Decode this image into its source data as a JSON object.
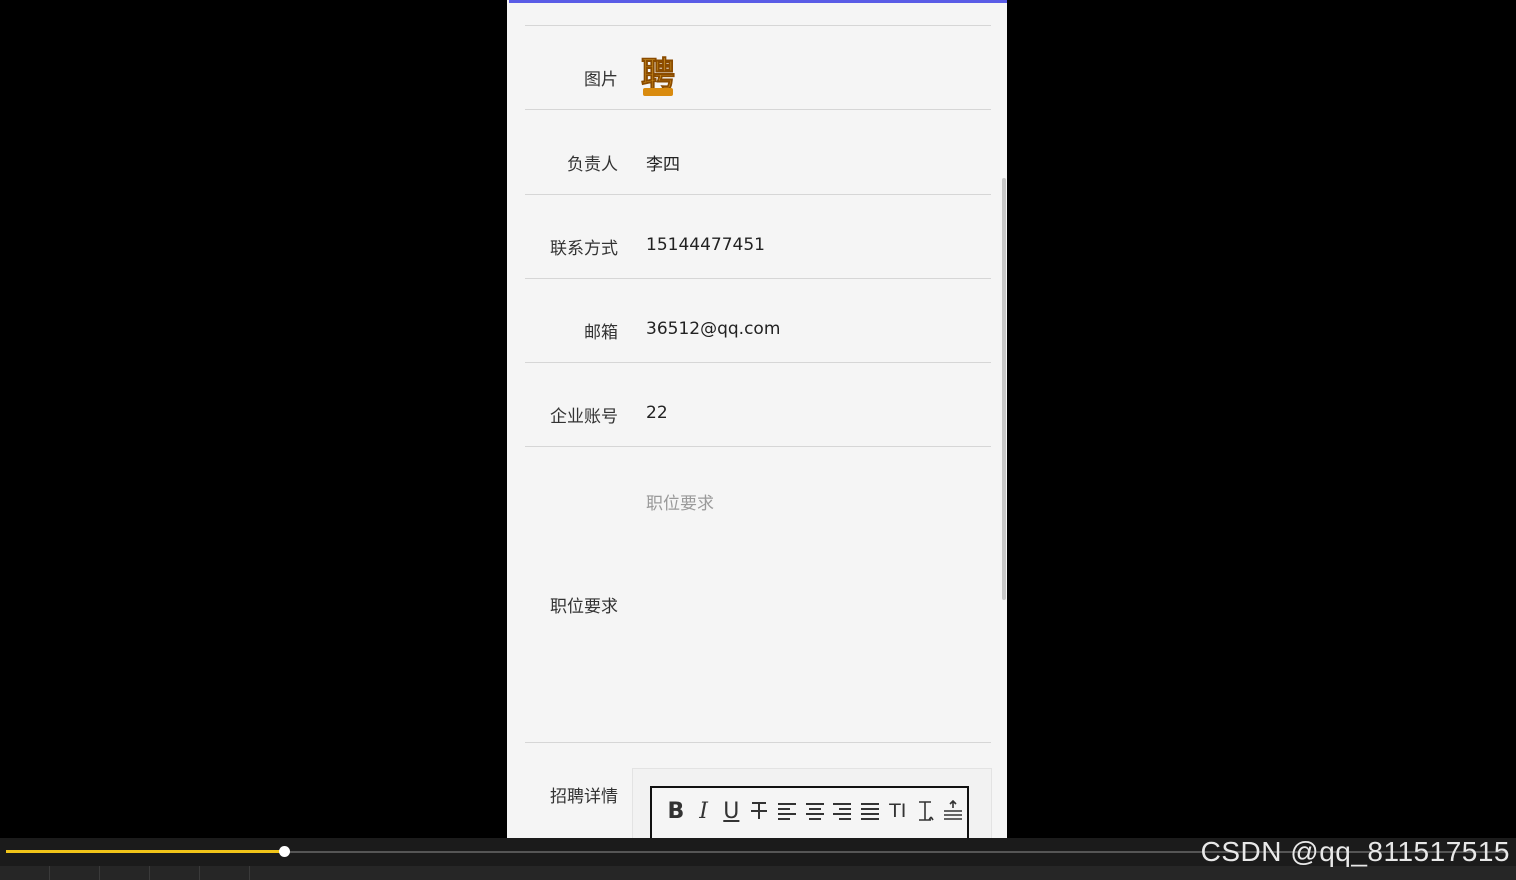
{
  "form": {
    "rows": [
      {
        "label": "图片",
        "value": ""
      },
      {
        "label": "负责人",
        "value": "李四"
      },
      {
        "label": "联系方式",
        "value": "15144477451"
      },
      {
        "label": "邮箱",
        "value": "36512@qq.com"
      },
      {
        "label": "企业账号",
        "value": "22"
      }
    ],
    "requirements": {
      "label": "职位要求",
      "placeholder": "职位要求"
    },
    "details": {
      "label": "招聘详情"
    },
    "logo_text": "聘"
  },
  "editor": {
    "tools": [
      "bold",
      "italic",
      "underline",
      "strikethrough",
      "align-left",
      "align-center",
      "align-right",
      "align-justify",
      "font-size",
      "line-height",
      "paragraph-spacing"
    ],
    "bold_glyph": "B",
    "italic_glyph": "I",
    "underline_glyph": "U",
    "fontsize_glyph": "TI"
  },
  "player": {
    "progress": 0.185
  },
  "watermark": "CSDN @qq_811517515",
  "colors": {
    "accent": "#5a5ce6",
    "progress": "#f0c419",
    "logo": "#e8a619"
  }
}
